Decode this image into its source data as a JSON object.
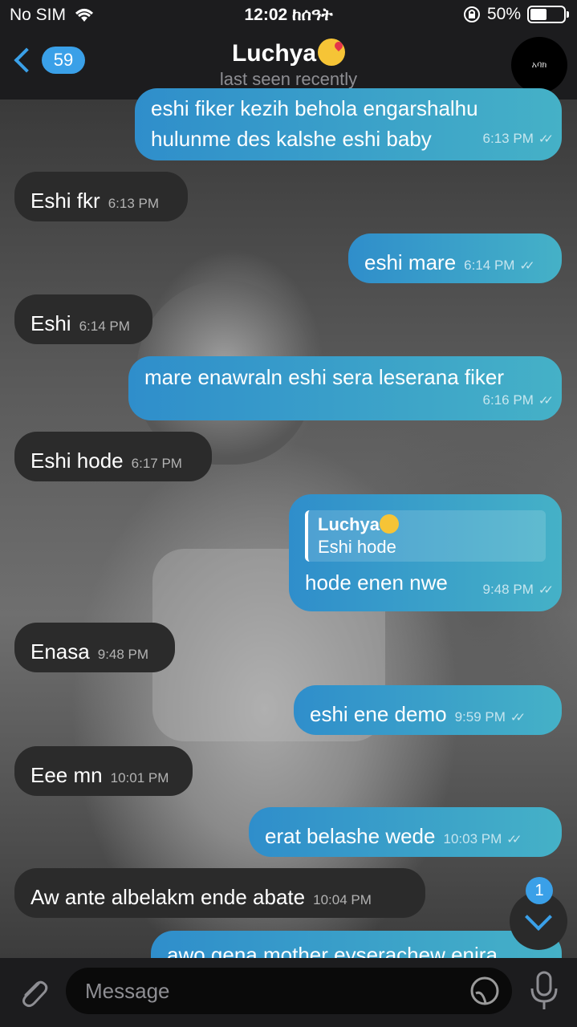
{
  "status": {
    "carrier": "No SIM",
    "time": "12:02 ከሰዓት",
    "battery": "50%"
  },
  "header": {
    "back_count": "59",
    "name": "Luchya",
    "status": "last seen recently",
    "avatar_text": "አባክ"
  },
  "messages": [
    {
      "dir": "out",
      "text": "eshi fiker kezih behola engarshalhu hulunme des kalshe eshi baby",
      "time": "6:13 PM"
    },
    {
      "dir": "in",
      "text": "Eshi fkr",
      "time": "6:13 PM"
    },
    {
      "dir": "out",
      "text": "eshi mare",
      "time": "6:14 PM"
    },
    {
      "dir": "in",
      "text": "Eshi",
      "time": "6:14 PM"
    },
    {
      "dir": "out",
      "text": "mare enawraln eshi sera leserana fiker",
      "time": "6:16 PM"
    },
    {
      "dir": "in",
      "text": "Eshi hode",
      "time": "6:17 PM"
    },
    {
      "dir": "out",
      "reply_name": "Luchya",
      "reply_text": "Eshi hode",
      "text": "hode enen nwe",
      "time": "9:48 PM"
    },
    {
      "dir": "in",
      "text": "Enasa",
      "time": "9:48 PM"
    },
    {
      "dir": "out",
      "text": "eshi ene demo",
      "time": "9:59 PM"
    },
    {
      "dir": "in",
      "text": "Eee mn",
      "time": "10:01 PM"
    },
    {
      "dir": "out",
      "text": "erat belashe wede",
      "time": "10:03 PM"
    },
    {
      "dir": "in",
      "text": "Aw ante albelakm ende abate",
      "time": "10:04 PM"
    },
    {
      "dir": "out",
      "text": "awo gena mother eyserachew enira",
      "time": ""
    }
  ],
  "scroll": {
    "unread": "1"
  },
  "input": {
    "placeholder": "Message"
  },
  "colors": {
    "accent": "#3aa0e8",
    "outgoing": "#3aa7c8",
    "incoming": "#2b2b2b"
  }
}
